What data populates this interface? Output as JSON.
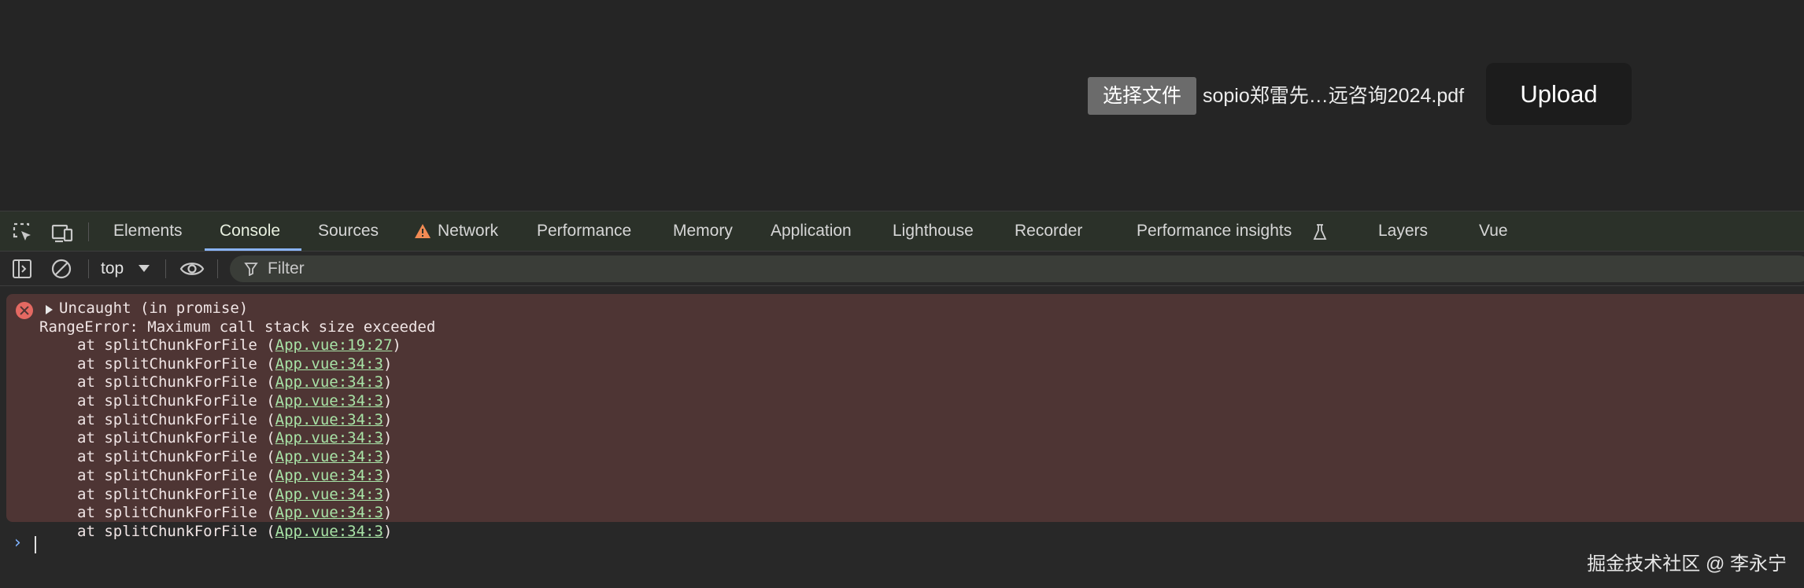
{
  "page": {
    "file_button_label": "选择文件",
    "file_name": "sopio郑雷先…远咨询2024.pdf",
    "upload_label": "Upload"
  },
  "devtools": {
    "tabs": [
      {
        "label": "Elements"
      },
      {
        "label": "Console",
        "active": true
      },
      {
        "label": "Sources"
      },
      {
        "label": "Network",
        "icon": "warning-icon"
      },
      {
        "label": "Performance"
      },
      {
        "label": "Memory"
      },
      {
        "label": "Application"
      },
      {
        "label": "Lighthouse"
      },
      {
        "label": "Recorder"
      },
      {
        "label": "Performance insights",
        "icon": "flask-icon"
      },
      {
        "label": "Layers"
      },
      {
        "label": "Vue"
      }
    ],
    "toolbar": {
      "context": "top",
      "filter_placeholder": "Filter"
    }
  },
  "console": {
    "error": {
      "summary": "Uncaught (in promise)",
      "message": "RangeError: Maximum call stack size exceeded",
      "stack": [
        {
          "func": "at splitChunkForFile (",
          "link": "App.vue:19:27",
          "close": ")"
        },
        {
          "func": "at splitChunkForFile (",
          "link": "App.vue:34:3",
          "close": ")"
        },
        {
          "func": "at splitChunkForFile (",
          "link": "App.vue:34:3",
          "close": ")"
        },
        {
          "func": "at splitChunkForFile (",
          "link": "App.vue:34:3",
          "close": ")"
        },
        {
          "func": "at splitChunkForFile (",
          "link": "App.vue:34:3",
          "close": ")"
        },
        {
          "func": "at splitChunkForFile (",
          "link": "App.vue:34:3",
          "close": ")"
        },
        {
          "func": "at splitChunkForFile (",
          "link": "App.vue:34:3",
          "close": ")"
        },
        {
          "func": "at splitChunkForFile (",
          "link": "App.vue:34:3",
          "close": ")"
        },
        {
          "func": "at splitChunkForFile (",
          "link": "App.vue:34:3",
          "close": ")"
        },
        {
          "func": "at splitChunkForFile (",
          "link": "App.vue:34:3",
          "close": ")"
        },
        {
          "func": "at splitChunkForFile (",
          "link": "App.vue:34:3",
          "close": ")"
        }
      ]
    },
    "prompt_symbol": "›"
  },
  "watermark": "掘金技术社区 @ 李永宁",
  "colors": {
    "page_bg": "#252525",
    "error_bg": "#4e3534",
    "link": "#a8e3a6",
    "tab_active_underline": "#8ab4f8",
    "error_icon": "#e46962"
  }
}
